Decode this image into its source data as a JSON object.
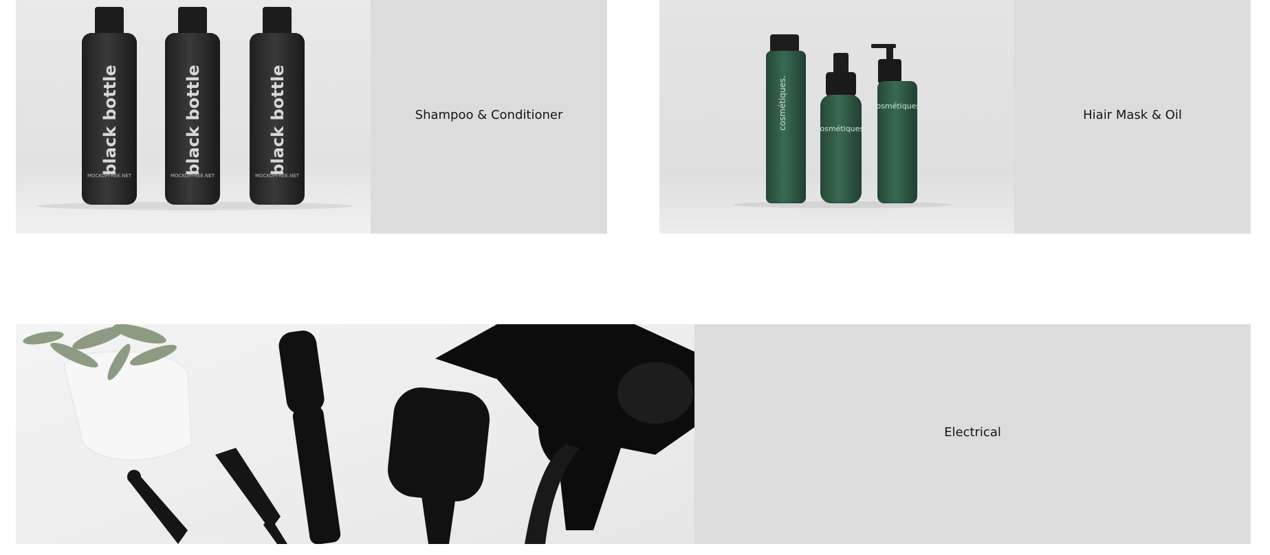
{
  "categories": [
    {
      "label": "Shampoo & Conditioner",
      "image_alt": "Three black shampoo bottles"
    },
    {
      "label": "Hiair Mask & Oil",
      "image_alt": "Green cosmetic bottles"
    },
    {
      "label": "Electrical",
      "image_alt": "Hair dryer, brushes and comb"
    }
  ],
  "bottle_text": {
    "black": "black bottle",
    "black_footer": "MOCKUPFREE.NET",
    "green": "cosmétiques."
  },
  "colors": {
    "card_background": "#dcdcdc",
    "text": "#141414",
    "bottle_black": "#2b2b2b",
    "bottle_green": "#2f5a44"
  }
}
